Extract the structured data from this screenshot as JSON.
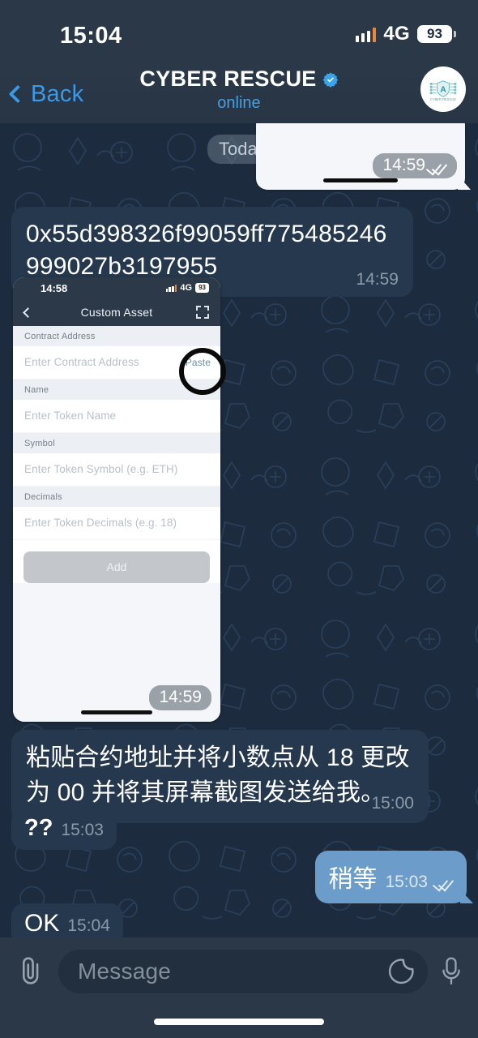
{
  "status_bar": {
    "time": "15:04",
    "network": "4G",
    "battery": "93"
  },
  "header": {
    "back_label": "Back",
    "title": "CYBER RESCUE",
    "status": "online",
    "verified_icon": "verified-badge-icon",
    "avatar_alt": "cyber-rescue-avatar"
  },
  "chat": {
    "date_divider": "Today",
    "messages": [
      {
        "id": "photo-top",
        "type": "photo",
        "direction": "out",
        "time": "14:59",
        "read": true
      },
      {
        "id": "contract-address",
        "type": "text",
        "direction": "in",
        "text": "0x55d398326f99059ff775485246999027b3197955",
        "time": "14:59"
      },
      {
        "id": "custom-asset-screenshot",
        "type": "photo",
        "direction": "in",
        "time": "14:59"
      },
      {
        "id": "instruction-cn",
        "type": "text",
        "direction": "in",
        "text": "粘贴合约地址并将小数点从 18 更改为 00 并将其屏幕截图发送给我。",
        "time": "15:00"
      },
      {
        "id": "question-marks",
        "type": "text",
        "direction": "in",
        "text": "??",
        "time": "15:03"
      },
      {
        "id": "wait-reply",
        "type": "text",
        "direction": "out",
        "text": "稍等",
        "time": "15:03",
        "read": true
      },
      {
        "id": "ok-msg",
        "type": "text",
        "direction": "in",
        "text": "OK",
        "time": "15:04"
      }
    ]
  },
  "embedded_screenshot": {
    "status_bar": {
      "time": "14:58",
      "network": "4G",
      "battery": "93"
    },
    "nav_title": "Custom Asset",
    "scan_icon": "qr-scan-icon",
    "fields": [
      {
        "label": "Contract Address",
        "placeholder": "Enter Contract Address",
        "value": "",
        "action": "Paste"
      },
      {
        "label": "Name",
        "placeholder": "Enter Token Name",
        "value": ""
      },
      {
        "label": "Symbol",
        "placeholder": "Enter Token Symbol (e.g. ETH)",
        "value": ""
      },
      {
        "label": "Decimals",
        "placeholder": "Enter Token Decimals (e.g. 18)",
        "value": ""
      }
    ],
    "submit_label": "Add",
    "annotation": "circle-highlight-on-paste"
  },
  "input_bar": {
    "attach_icon": "paperclip-icon",
    "placeholder": "Message",
    "sticker_icon": "sticker-icon",
    "mic_icon": "microphone-icon"
  },
  "colors": {
    "background": "#1c2c3e",
    "header": "#2a3848",
    "bubble_in": "#25384e",
    "bubble_out": "#6c9cc9",
    "accent_blue": "#3b9ae8",
    "signal_alert": "#e8873a"
  }
}
